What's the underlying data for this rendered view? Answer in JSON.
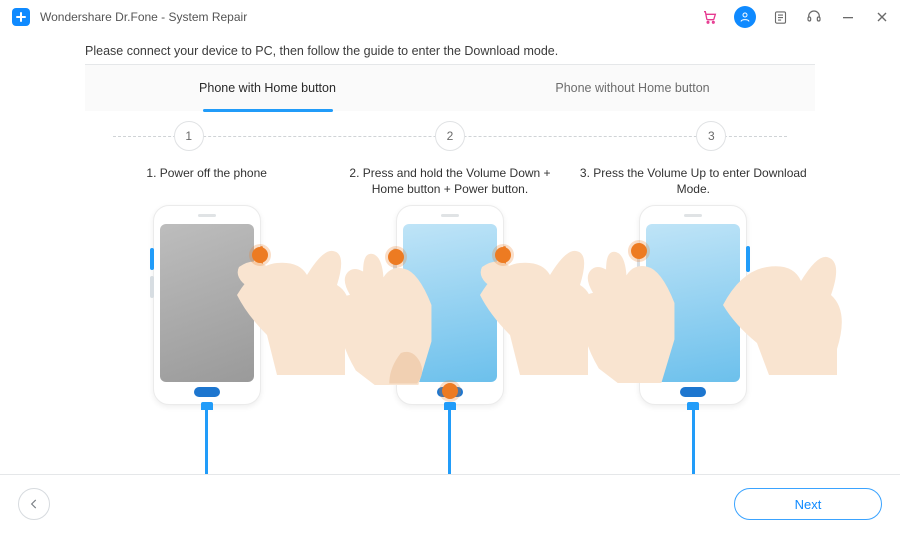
{
  "title": "Wondershare Dr.Fone - System Repair",
  "instruction": "Please connect your device to PC, then follow the guide to enter the Download mode.",
  "tabs": {
    "with_home": "Phone with Home button",
    "without_home": "Phone without Home button"
  },
  "steps": {
    "n1": "1",
    "n2": "2",
    "n3": "3",
    "c1": "1. Power off the phone",
    "c2": "2. Press and hold the Volume Down + Home button + Power button.",
    "c3": "3. Press the Volume Up to enter Download Mode."
  },
  "footer": {
    "next": "Next"
  }
}
